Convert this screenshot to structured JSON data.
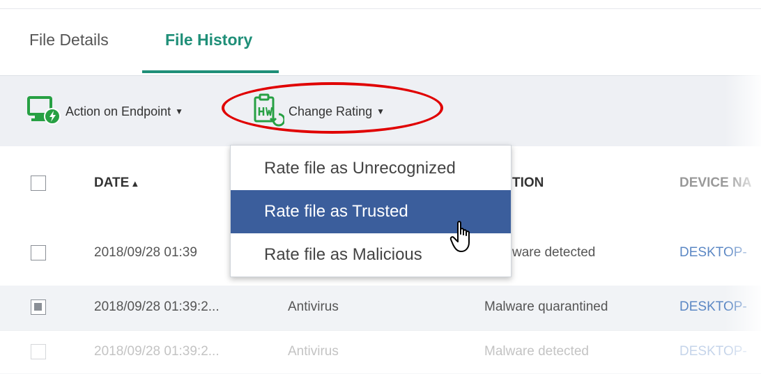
{
  "tabs": {
    "file_details": "File Details",
    "file_history": "File History",
    "active": "file_history"
  },
  "toolbar": {
    "action_on_endpoint": "Action on Endpoint",
    "change_rating": "Change Rating"
  },
  "dropdown": {
    "items": [
      {
        "label": "Rate file as Unrecognized"
      },
      {
        "label": "Rate file as Trusted",
        "highlighted": true
      },
      {
        "label": "Rate file as Malicious"
      }
    ]
  },
  "table": {
    "headers": {
      "date": "DATE",
      "sort_indicator": "▲",
      "action": "TION",
      "device": "DEVICE NA"
    },
    "rows": [
      {
        "date": "2018/09/28 01:39",
        "source": "",
        "action": "ware detected",
        "device": "DESKTOP-",
        "checked": false
      },
      {
        "date": "2018/09/28 01:39:2...",
        "source": "Antivirus",
        "action": "Malware quarantined",
        "device": "DESKTOP-",
        "checked": true
      },
      {
        "date": "2018/09/28 01:39:2...",
        "source": "Antivirus",
        "action": "Malware detected",
        "device": "DESKTOP-",
        "checked": false
      }
    ]
  },
  "colors": {
    "accent_green": "#1f8f78",
    "highlight_red": "#e00000",
    "menu_selected": "#3b5e9c",
    "link_blue": "#5b87c4"
  }
}
